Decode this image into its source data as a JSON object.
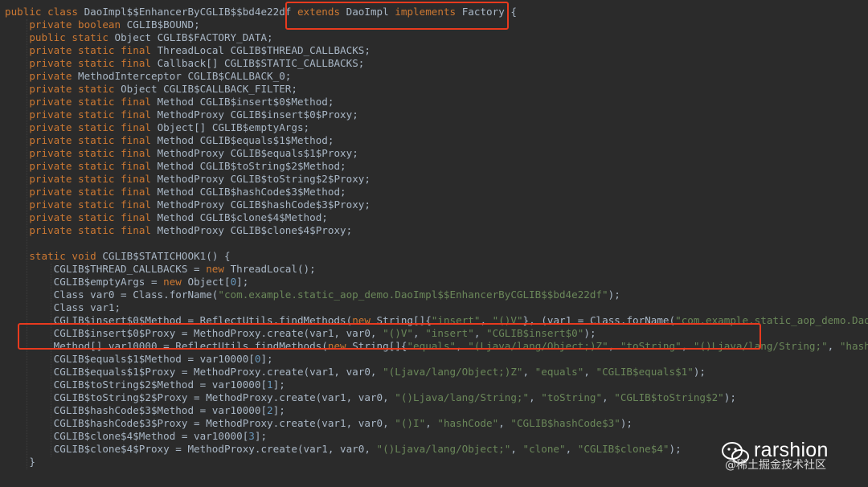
{
  "code_lines": [
    {
      "tokens": [
        [
          "kw",
          "public class "
        ],
        [
          "txt",
          "DaoImpl$$EnhancerByCGLIB$$bd4e22df "
        ],
        [
          "kw",
          "extends "
        ],
        [
          "txt",
          "DaoImpl "
        ],
        [
          "kw",
          "implements "
        ],
        [
          "txt",
          "Factory {"
        ]
      ]
    },
    {
      "tokens": [
        [
          "txt",
          "    "
        ],
        [
          "kw",
          "private boolean "
        ],
        [
          "txt",
          "CGLIB$BOUND;"
        ]
      ]
    },
    {
      "tokens": [
        [
          "txt",
          "    "
        ],
        [
          "kw",
          "public static "
        ],
        [
          "txt",
          "Object CGLIB$FACTORY_DATA;"
        ]
      ]
    },
    {
      "tokens": [
        [
          "txt",
          "    "
        ],
        [
          "kw",
          "private static final "
        ],
        [
          "txt",
          "ThreadLocal CGLIB$THREAD_CALLBACKS;"
        ]
      ]
    },
    {
      "tokens": [
        [
          "txt",
          "    "
        ],
        [
          "kw",
          "private static final "
        ],
        [
          "txt",
          "Callback[] CGLIB$STATIC_CALLBACKS;"
        ]
      ]
    },
    {
      "tokens": [
        [
          "txt",
          "    "
        ],
        [
          "kw",
          "private "
        ],
        [
          "txt",
          "MethodInterceptor CGLIB$CALLBACK_0;"
        ]
      ]
    },
    {
      "tokens": [
        [
          "txt",
          "    "
        ],
        [
          "kw",
          "private static "
        ],
        [
          "txt",
          "Object CGLIB$CALLBACK_FILTER;"
        ]
      ]
    },
    {
      "tokens": [
        [
          "txt",
          "    "
        ],
        [
          "kw",
          "private static final "
        ],
        [
          "txt",
          "Method CGLIB$insert$0$Method;"
        ]
      ]
    },
    {
      "tokens": [
        [
          "txt",
          "    "
        ],
        [
          "kw",
          "private static final "
        ],
        [
          "txt",
          "MethodProxy CGLIB$insert$0$Proxy;"
        ]
      ]
    },
    {
      "tokens": [
        [
          "txt",
          "    "
        ],
        [
          "kw",
          "private static final "
        ],
        [
          "txt",
          "Object[] CGLIB$emptyArgs;"
        ]
      ]
    },
    {
      "tokens": [
        [
          "txt",
          "    "
        ],
        [
          "kw",
          "private static final "
        ],
        [
          "txt",
          "Method CGLIB$equals$1$Method;"
        ]
      ]
    },
    {
      "tokens": [
        [
          "txt",
          "    "
        ],
        [
          "kw",
          "private static final "
        ],
        [
          "txt",
          "MethodProxy CGLIB$equals$1$Proxy;"
        ]
      ]
    },
    {
      "tokens": [
        [
          "txt",
          "    "
        ],
        [
          "kw",
          "private static final "
        ],
        [
          "txt",
          "Method CGLIB$toString$2$Method;"
        ]
      ]
    },
    {
      "tokens": [
        [
          "txt",
          "    "
        ],
        [
          "kw",
          "private static final "
        ],
        [
          "txt",
          "MethodProxy CGLIB$toString$2$Proxy;"
        ]
      ]
    },
    {
      "tokens": [
        [
          "txt",
          "    "
        ],
        [
          "kw",
          "private static final "
        ],
        [
          "txt",
          "Method CGLIB$hashCode$3$Method;"
        ]
      ]
    },
    {
      "tokens": [
        [
          "txt",
          "    "
        ],
        [
          "kw",
          "private static final "
        ],
        [
          "txt",
          "MethodProxy CGLIB$hashCode$3$Proxy;"
        ]
      ]
    },
    {
      "tokens": [
        [
          "txt",
          "    "
        ],
        [
          "kw",
          "private static final "
        ],
        [
          "txt",
          "Method CGLIB$clone$4$Method;"
        ]
      ]
    },
    {
      "tokens": [
        [
          "txt",
          "    "
        ],
        [
          "kw",
          "private static final "
        ],
        [
          "txt",
          "MethodProxy CGLIB$clone$4$Proxy;"
        ]
      ]
    },
    {
      "tokens": []
    },
    {
      "tokens": [
        [
          "txt",
          "    "
        ],
        [
          "kw",
          "static void "
        ],
        [
          "txt",
          "CGLIB$STATICHOOK1() {"
        ]
      ]
    },
    {
      "tokens": [
        [
          "txt",
          "        CGLIB$THREAD_CALLBACKS = "
        ],
        [
          "kw",
          "new "
        ],
        [
          "txt",
          "ThreadLocal();"
        ]
      ]
    },
    {
      "tokens": [
        [
          "txt",
          "        CGLIB$emptyArgs = "
        ],
        [
          "kw",
          "new "
        ],
        [
          "txt",
          "Object["
        ],
        [
          "num",
          "0"
        ],
        [
          "txt",
          "];"
        ]
      ]
    },
    {
      "tokens": [
        [
          "txt",
          "        Class var0 = Class.forName("
        ],
        [
          "str",
          "\"com.example.static_aop_demo.DaoImpl$$EnhancerByCGLIB$$bd4e22df\""
        ],
        [
          "txt",
          ");"
        ]
      ]
    },
    {
      "tokens": [
        [
          "txt",
          "        Class var1;"
        ]
      ]
    },
    {
      "tokens": [
        [
          "txt",
          "        CGLIB$insert$0$Method = ReflectUtils.findMethods("
        ],
        [
          "kw",
          "new "
        ],
        [
          "txt",
          "String[]{"
        ],
        [
          "str",
          "\"insert\""
        ],
        [
          "txt",
          ", "
        ],
        [
          "str",
          "\"()V\""
        ],
        [
          "txt",
          "}, (var1 = Class.forName("
        ],
        [
          "str",
          "\"com.example.static_aop_demo.DaoImpl\""
        ]
      ]
    },
    {
      "tokens": [
        [
          "txt",
          "        CGLIB$insert$0$Proxy = MethodProxy.create(var1, var0, "
        ],
        [
          "str",
          "\"()V\""
        ],
        [
          "txt",
          ", "
        ],
        [
          "str",
          "\"insert\""
        ],
        [
          "txt",
          ", "
        ],
        [
          "str",
          "\"CGLIB$insert$0\""
        ],
        [
          "txt",
          ");"
        ]
      ]
    },
    {
      "tokens": [
        [
          "txt",
          "        Method[] var10000 = ReflectUtils.findMethods("
        ],
        [
          "kw",
          "new "
        ],
        [
          "txt",
          "String[]{"
        ],
        [
          "str",
          "\"equals\""
        ],
        [
          "txt",
          ", "
        ],
        [
          "str",
          "\"(Ljava/lang/Object;)Z\""
        ],
        [
          "txt",
          ", "
        ],
        [
          "str",
          "\"toString\""
        ],
        [
          "txt",
          ", "
        ],
        [
          "str",
          "\"()Ljava/lang/String;\""
        ],
        [
          "txt",
          ", "
        ],
        [
          "str",
          "\"hashCode\""
        ]
      ]
    },
    {
      "tokens": [
        [
          "txt",
          "        CGLIB$equals$1$Method = var10000["
        ],
        [
          "num",
          "0"
        ],
        [
          "txt",
          "];"
        ]
      ]
    },
    {
      "tokens": [
        [
          "txt",
          "        CGLIB$equals$1$Proxy = MethodProxy.create(var1, var0, "
        ],
        [
          "str",
          "\"(Ljava/lang/Object;)Z\""
        ],
        [
          "txt",
          ", "
        ],
        [
          "str",
          "\"equals\""
        ],
        [
          "txt",
          ", "
        ],
        [
          "str",
          "\"CGLIB$equals$1\""
        ],
        [
          "txt",
          ");"
        ]
      ]
    },
    {
      "tokens": [
        [
          "txt",
          "        CGLIB$toString$2$Method = var10000["
        ],
        [
          "num",
          "1"
        ],
        [
          "txt",
          "];"
        ]
      ]
    },
    {
      "tokens": [
        [
          "txt",
          "        CGLIB$toString$2$Proxy = MethodProxy.create(var1, var0, "
        ],
        [
          "str",
          "\"()Ljava/lang/String;\""
        ],
        [
          "txt",
          ", "
        ],
        [
          "str",
          "\"toString\""
        ],
        [
          "txt",
          ", "
        ],
        [
          "str",
          "\"CGLIB$toString$2\""
        ],
        [
          "txt",
          ");"
        ]
      ]
    },
    {
      "tokens": [
        [
          "txt",
          "        CGLIB$hashCode$3$Method = var10000["
        ],
        [
          "num",
          "2"
        ],
        [
          "txt",
          "];"
        ]
      ]
    },
    {
      "tokens": [
        [
          "txt",
          "        CGLIB$hashCode$3$Proxy = MethodProxy.create(var1, var0, "
        ],
        [
          "str",
          "\"()I\""
        ],
        [
          "txt",
          ", "
        ],
        [
          "str",
          "\"hashCode\""
        ],
        [
          "txt",
          ", "
        ],
        [
          "str",
          "\"CGLIB$hashCode$3\""
        ],
        [
          "txt",
          ");"
        ]
      ]
    },
    {
      "tokens": [
        [
          "txt",
          "        CGLIB$clone$4$Method = var10000["
        ],
        [
          "num",
          "3"
        ],
        [
          "txt",
          "];"
        ]
      ]
    },
    {
      "tokens": [
        [
          "txt",
          "        CGLIB$clone$4$Proxy = MethodProxy.create(var1, var0, "
        ],
        [
          "str",
          "\"()Ljava/lang/Object;\""
        ],
        [
          "txt",
          ", "
        ],
        [
          "str",
          "\"clone\""
        ],
        [
          "txt",
          ", "
        ],
        [
          "str",
          "\"CGLIB$clone$4\""
        ],
        [
          "txt",
          ");"
        ]
      ]
    },
    {
      "tokens": [
        [
          "txt",
          "    }"
        ]
      ]
    }
  ],
  "highlight_color": "#e83a1e",
  "syntax_colors": {
    "background": "#2b2b2b",
    "keyword": "#cc7832",
    "string": "#6a8759",
    "number": "#6897bb",
    "text": "#a9b7c6"
  },
  "watermark": {
    "name": "rarshion",
    "site": "@稀土掘金技术社区",
    "logo_icon": "wechat-icon"
  }
}
